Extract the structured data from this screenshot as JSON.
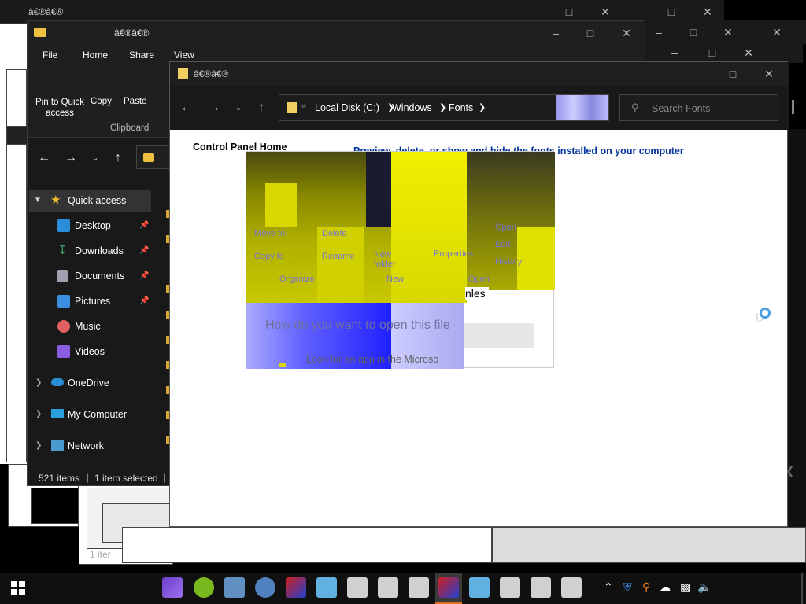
{
  "windows": {
    "back_title": "â€®â€®",
    "explorer_title": "â€®â€®",
    "fonts_title": "â€®â€®"
  },
  "explorer": {
    "tabs": [
      "File",
      "Home",
      "Share",
      "View"
    ],
    "ribbon": {
      "pin_label": "Pin to Quick access",
      "copy_label": "Copy",
      "paste_label": "Paste",
      "group_label": "Clipboard"
    },
    "sidebar": {
      "quick_access": "Quick access",
      "items": [
        {
          "label": "Desktop",
          "icon": "desktop-icon",
          "color": "#2a8fd8"
        },
        {
          "label": "Downloads",
          "icon": "downloads-icon",
          "color": "#3aa46a"
        },
        {
          "label": "Documents",
          "icon": "documents-icon",
          "color": "#a0a0b0"
        },
        {
          "label": "Pictures",
          "icon": "pictures-icon",
          "color": "#3a8ee0"
        },
        {
          "label": "Music",
          "icon": "music-icon",
          "color": "#e06060"
        },
        {
          "label": "Videos",
          "icon": "videos-icon",
          "color": "#8a5ce0"
        }
      ],
      "onedrive": "OneDrive",
      "my_computer": "My Computer",
      "network": "Network"
    },
    "status": {
      "items": "521 items",
      "selected": "1 item selected"
    },
    "ghost_status": "1 iter"
  },
  "fonts": {
    "breadcrumb": [
      "Local Disk (C:)",
      "Windows",
      "Fonts"
    ],
    "search_placeholder": "Search Fonts",
    "control_panel_home": "Control Panel Home",
    "preview_text": "Preview, delete, or show and hide the fonts installed on your computer"
  },
  "glitch": {
    "move_to": "Move to",
    "copy_to": "Copy to",
    "delete": "Delete",
    "rename": "Rename",
    "new_folder": "New folder",
    "organize": "Organize",
    "new": "New",
    "properties": "Properties",
    "open": "Open",
    "edit": "Edit",
    "history": "History",
    "open2": "Open",
    "files_fragment": "nles",
    "dialog_question": "How do you want to open this file",
    "dialog_link": "Look for an app in the Microso"
  },
  "colors": {
    "accent_yellow": "#e6e600",
    "accent_blue": "#1a1aff",
    "link_blue": "#003399"
  }
}
